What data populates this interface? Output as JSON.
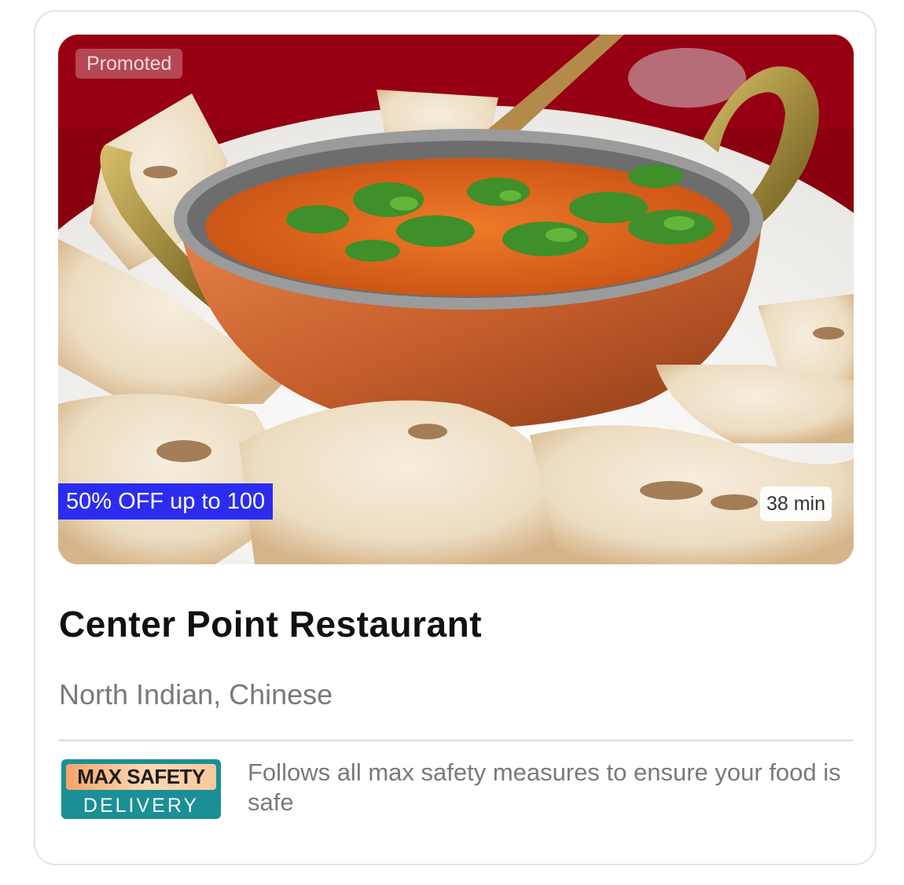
{
  "card": {
    "promoted_label": "Promoted",
    "offer_label": "50% OFF up to 100",
    "delivery_time": "38 min",
    "restaurant_name": "Center Point Restaurant",
    "cuisines": "North Indian, Chinese",
    "safety_badge": {
      "line1": "MAX SAFETY",
      "line2": "DELIVERY"
    },
    "safety_text": "Follows all max safety measures to ensure your food is safe"
  },
  "colors": {
    "offer_bg": "#2c2cf0",
    "badge_teal": "#1a8f95",
    "muted_text": "#7a7a7a"
  },
  "image": {
    "subject": "curry-in-copper-bowl-with-naan"
  }
}
